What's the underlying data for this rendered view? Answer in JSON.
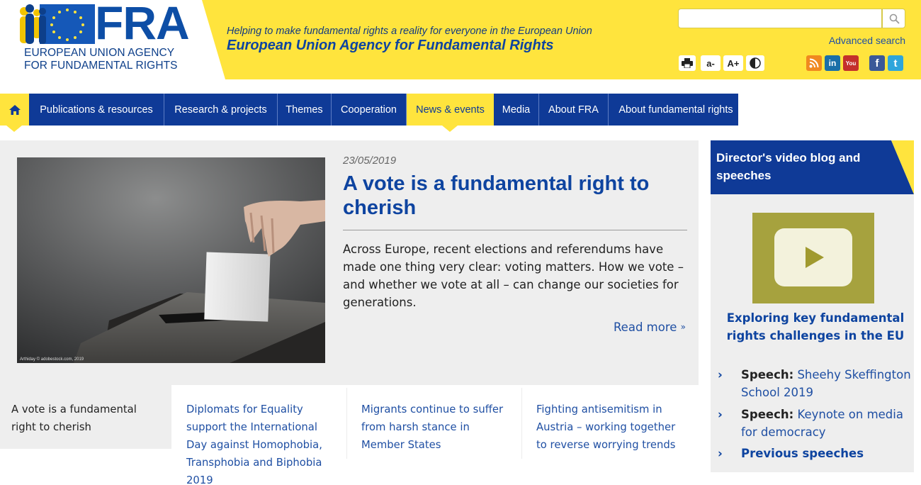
{
  "header": {
    "logo_text": "FRA",
    "logo_line1": "EUROPEAN UNION AGENCY",
    "logo_line2": "FOR FUNDAMENTAL RIGHTS",
    "tagline": "Helping to make fundamental rights a reality for everyone in the European Union",
    "agency_name": "European Union Agency for Fundamental Rights",
    "search_placeholder": "",
    "advanced_search": "Advanced search",
    "tools": {
      "print": "print-icon",
      "font_smaller": "a-",
      "font_larger": "A+",
      "contrast": "contrast-icon"
    },
    "social": [
      {
        "name": "rss-icon",
        "color": "#f0891f"
      },
      {
        "name": "linkedin-icon",
        "label": "in",
        "color": "#1a6fa8"
      },
      {
        "name": "youtube-icon",
        "label": "You",
        "color": "#c4302b"
      },
      {
        "name": "facebook-icon",
        "label": "f",
        "color": "#3b5998"
      },
      {
        "name": "twitter-icon",
        "label": "t",
        "color": "#2ea5db"
      }
    ]
  },
  "nav": {
    "items": [
      "Publications & resources",
      "Research & projects",
      "Themes",
      "Cooperation",
      "News & events",
      "Media",
      "About FRA",
      "About fundamental rights"
    ],
    "active": "News & events"
  },
  "feature": {
    "image_credit": "Arthiday © adobestock.com, 2019",
    "date": "23/05/2019",
    "title": "A vote is a fundamental right to cherish",
    "summary": "Across Europe, recent elections and referendums have made one thing very clear: voting matters. How we vote – and whether we vote at all – can change our societies for generations.",
    "read_more": "Read more"
  },
  "tabs": [
    "A vote is a fundamental right to cherish",
    "Diplomats for Equality support the International Day against Homophobia, Transphobia and Biphobia 2019",
    "Migrants continue to suffer from harsh stance in Member States",
    "Fighting antisemitism in Austria – working together to reverse worrying trends"
  ],
  "sidebar": {
    "title": "Director's video blog and speeches",
    "video_caption": "Exploring key fundamental rights challenges in the EU",
    "speech_prefix": "Speech:",
    "speeches": [
      "Sheehy Skeffington School 2019",
      "Keynote on media for democracy"
    ],
    "previous": "Previous speeches"
  },
  "colors": {
    "brand_blue": "#0f3a97",
    "brand_yellow": "#ffe43d",
    "link_blue": "#1f4fa3"
  }
}
